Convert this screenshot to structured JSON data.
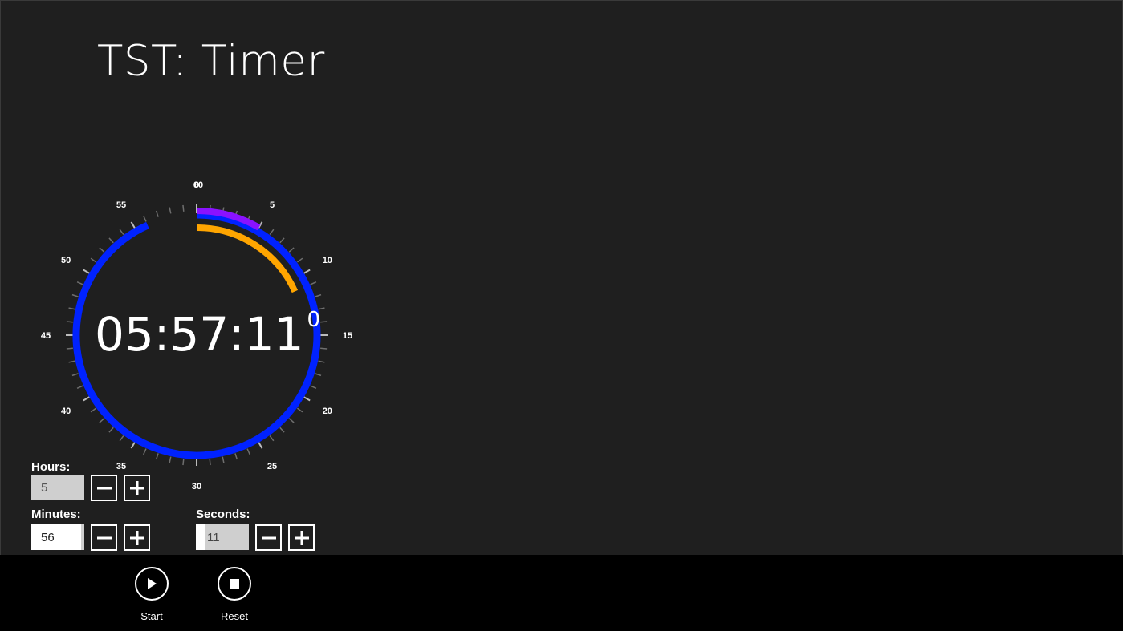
{
  "app": {
    "title": "TST: Timer"
  },
  "dial": {
    "display": "05:57:11",
    "display_fraction": "0",
    "top_label_overlap": "60",
    "tick_labels": [
      "0",
      "5",
      "10",
      "15",
      "20",
      "25",
      "30",
      "35",
      "40",
      "45",
      "50",
      "55"
    ],
    "rings": {
      "hours": {
        "value": 5,
        "max": 60,
        "color": "#8a12ff"
      },
      "minutes": {
        "value": 56,
        "max": 60,
        "color": "#0022ff"
      },
      "seconds": {
        "value": 11,
        "max": 60,
        "color": "#ffa500"
      }
    }
  },
  "controls": {
    "hours": {
      "label": "Hours:",
      "value": "5"
    },
    "minutes": {
      "label": "Minutes:",
      "value": "56"
    },
    "seconds": {
      "label": "Seconds:",
      "value": "11"
    }
  },
  "appbar": {
    "start_label": "Start",
    "reset_label": "Reset"
  },
  "colors": {
    "background": "#1f1f1f",
    "appbar": "#000000"
  }
}
